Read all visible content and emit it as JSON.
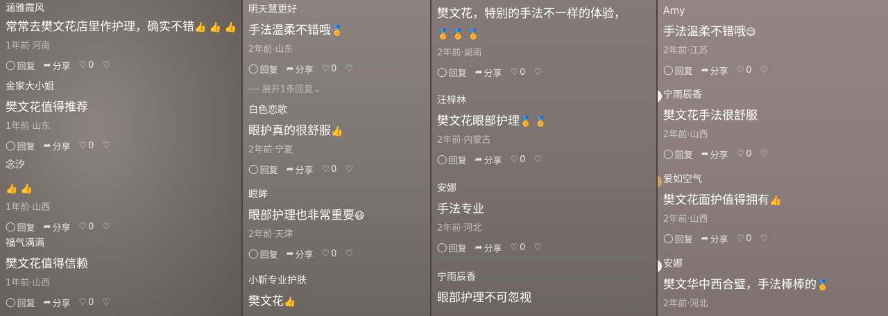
{
  "icons": {
    "reply": "◯",
    "share": "➦",
    "like": "♡",
    "dislike": "♡"
  },
  "labels": {
    "reply": "回复",
    "share": "分享",
    "like_count": "0"
  },
  "columns": [
    {
      "comments": [
        {
          "user": "涵雅霞风",
          "text": "常常去樊文花店里作护理，确实不错",
          "emoji": "👍 👍 👍",
          "meta": "1年前·河南"
        },
        {
          "user": "金家大小姐",
          "text": "樊文花值得推荐",
          "emoji": "",
          "meta": "1年前·山东"
        },
        {
          "user": "念汐",
          "text": "",
          "emoji": "👍 👍",
          "meta": "1年前·山西"
        },
        {
          "user": "福气满满",
          "text": "樊文花值得信赖",
          "emoji": "",
          "meta": "1年前·山西"
        }
      ]
    },
    {
      "comments": [
        {
          "user": "明天慧更好",
          "text": "手法温柔不错哦",
          "emoji": "🏅",
          "meta": "2年前·山东"
        },
        {
          "user": "白色恋歌",
          "text": "眼护真的很舒服",
          "emoji": "👍",
          "meta": "2年前·宁夏"
        },
        {
          "user": "眼眸",
          "text": "眼部护理也非常重要",
          "emoji": "😷",
          "meta": "2年前·天津"
        },
        {
          "user": "小靳专业护肤",
          "text": "樊文花",
          "emoji": "👍",
          "meta": ""
        }
      ],
      "expand": "展开1条回复"
    },
    {
      "comments": [
        {
          "user": "",
          "text": "樊文花，特别的手法不一样的体验，",
          "emoji": "🏅 🏅 🏅",
          "meta": "2年前·湖南"
        },
        {
          "user": "汪梓林",
          "text": "樊文花眼部护理",
          "emoji": "🏅 🏅",
          "meta": "2年前·内蒙古"
        },
        {
          "user": "安娜",
          "text": "手法专业",
          "emoji": "",
          "meta": "2年前·河北"
        },
        {
          "user": "宁雨辰香",
          "text": "眼部护理不可忽视",
          "emoji": "",
          "meta": ""
        }
      ]
    },
    {
      "comments": [
        {
          "user": "Amy",
          "text": "手法温柔不错哦",
          "emoji": "😌",
          "meta": "2年前·江苏"
        },
        {
          "user": "宁雨辰香",
          "text": "樊文花手法很舒服",
          "emoji": "",
          "meta": "2年前·山西"
        },
        {
          "user": "爱如空气",
          "text": "樊文花面护值得拥有",
          "emoji": "👍",
          "meta": "2年前·山西"
        },
        {
          "user": "安娜",
          "text": "樊文华中西合璧，手法棒棒的",
          "emoji": "🏅",
          "meta": "2年前·河北"
        }
      ]
    }
  ]
}
